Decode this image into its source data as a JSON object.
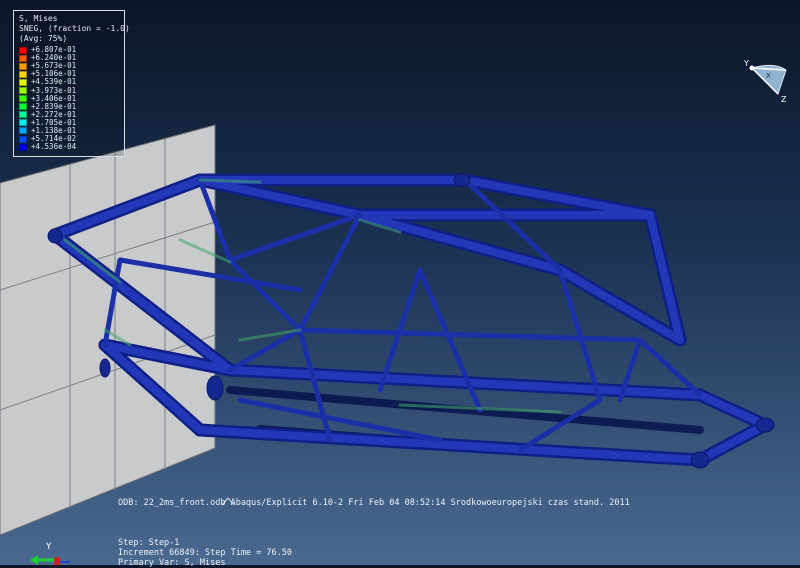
{
  "legend": {
    "title_line1": "S, Mises",
    "title_line2": "SNEG, (fraction = -1.0)",
    "title_line3": "(Avg: 75%)",
    "entries": [
      {
        "value": "+6.807e-01",
        "color": "#ff0000"
      },
      {
        "value": "+6.240e-01",
        "color": "#ff5a00"
      },
      {
        "value": "+5.673e-01",
        "color": "#ff9b00"
      },
      {
        "value": "+5.106e-01",
        "color": "#ffd500"
      },
      {
        "value": "+4.539e-01",
        "color": "#e6ff00"
      },
      {
        "value": "+3.973e-01",
        "color": "#9bff00"
      },
      {
        "value": "+3.406e-01",
        "color": "#3cff00"
      },
      {
        "value": "+2.839e-01",
        "color": "#00ff3c"
      },
      {
        "value": "+2.272e-01",
        "color": "#00ff9b"
      },
      {
        "value": "+1.705e-01",
        "color": "#00f0f0"
      },
      {
        "value": "+1.138e-01",
        "color": "#00a5ff"
      },
      {
        "value": "+5.714e-02",
        "color": "#0050ff"
      },
      {
        "value": "+4.536e-04",
        "color": "#0000ff"
      }
    ]
  },
  "footer": {
    "odb_line": "ODB: 22_2ms_front.odb    Abaqus/Explicit 6.10-2    Fri Feb 04 08:52:14 Srodkowoeuropejski czas stand. 2011",
    "step_line": "Step: Step-1",
    "increment_line": "Increment     66849: Step Time =    76.50",
    "primary_var_line": "Primary Var: S, Mises"
  },
  "triad": {
    "y_label": "Y",
    "z_label": "Z",
    "x_label": "X"
  },
  "bottom_triad": {
    "y_label": "Y"
  },
  "colors": {
    "frame_blue": "#1a2fa8",
    "frame_dark": "#0d1a6e",
    "stress_green": "#4fd06a",
    "wall_fill": "#c9cbcd",
    "wall_grid": "#7e8083"
  }
}
